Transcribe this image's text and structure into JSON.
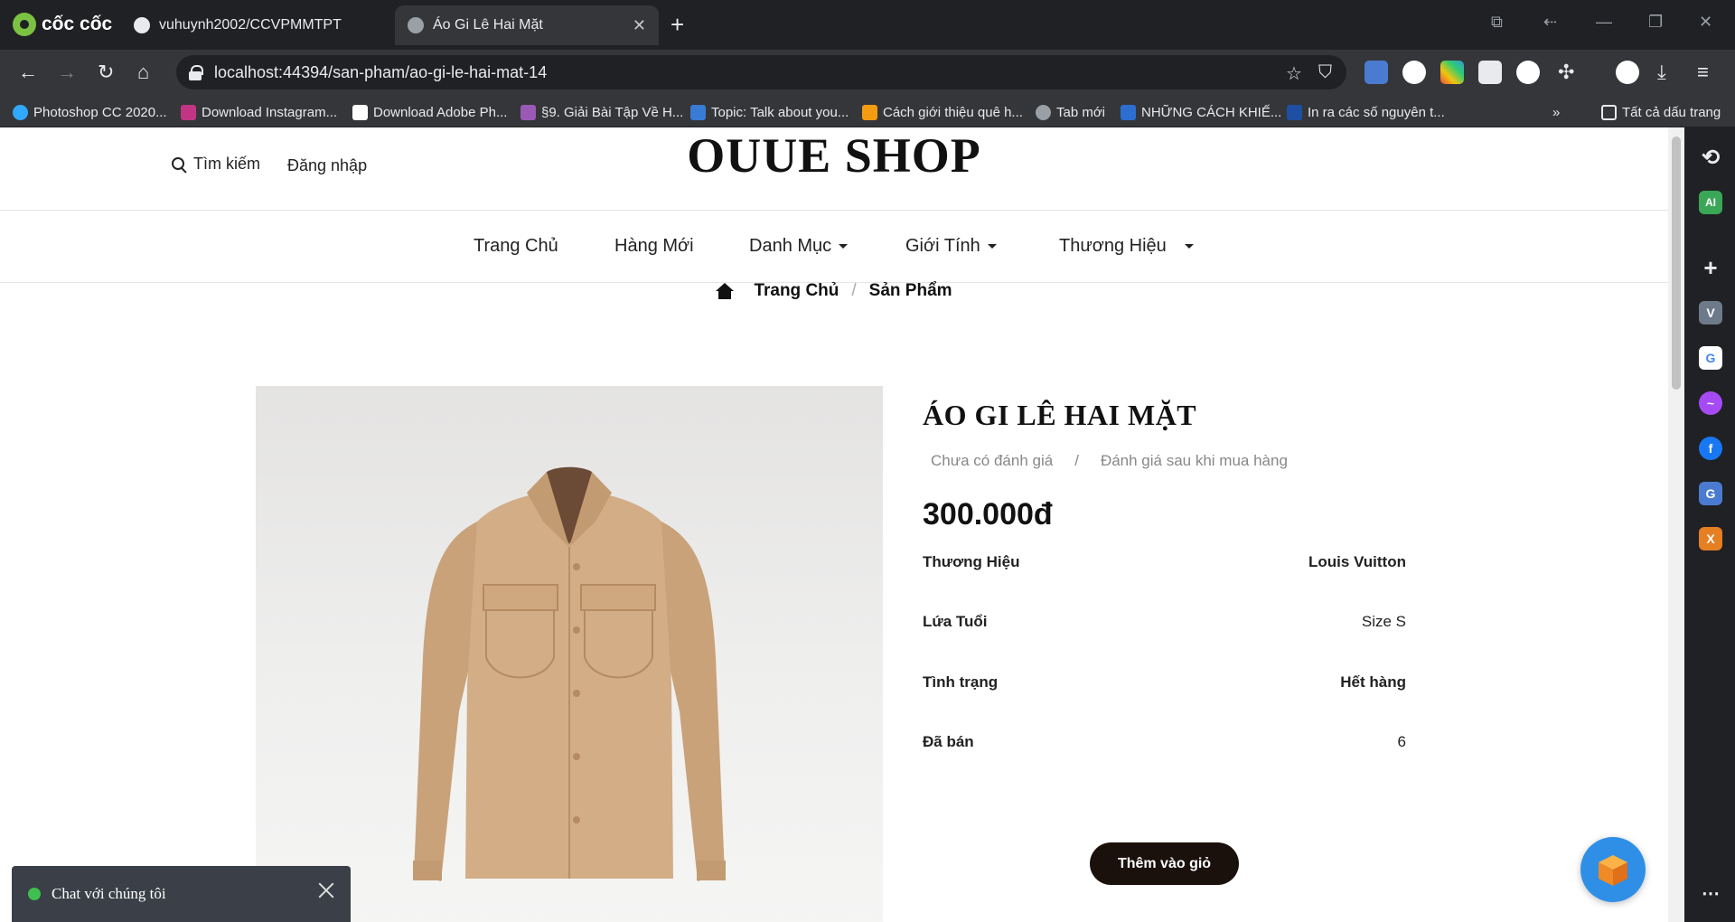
{
  "browser": {
    "brand": "cốc cốc",
    "tabs": [
      {
        "title": "vuhuynh2002/CCVPMMTPT",
        "active": false
      },
      {
        "title": "Áo Gi Lê Hai Mặt",
        "active": true
      }
    ],
    "url": "localhost:44394/san-pham/ao-gi-le-hai-mat-14",
    "bookmarks": [
      "Photoshop CC 2020...",
      "Download Instagram...",
      "Download Adobe Ph...",
      "§9. Giải Bài Tập Về H...",
      "Topic: Talk about you...",
      "Cách giới thiệu quê h...",
      "Tab mới",
      "NHỮNG CÁCH KHIẾ...",
      "In ra các số nguyên t..."
    ],
    "all_bookmarks": "Tất cả dấu trang"
  },
  "shop": {
    "name": "OUUE SHOP",
    "search_label": "Tìm kiếm",
    "login_label": "Đăng nhập",
    "nav": [
      "Trang Chủ",
      "Hàng Mới",
      "Danh Mục",
      "Giới Tính",
      "Thương Hiệu"
    ],
    "breadcrumb": {
      "home": "Trang Chủ",
      "current": "Sản Phẩm"
    }
  },
  "product": {
    "title": "ÁO GI LÊ HAI MẶT",
    "rating_text": "Chưa có đánh giá",
    "rating_sep": "/",
    "rating_note": "Đánh giá sau khi mua hàng",
    "price": "300.000đ",
    "specs": [
      {
        "label": "Thương Hiệu",
        "value": "Louis Vuitton"
      },
      {
        "label": "Lứa Tuổi",
        "value": "Size S"
      },
      {
        "label": "Tình trạng",
        "value": "Hết hàng"
      },
      {
        "label": "Đã bán",
        "value": "6"
      }
    ],
    "add_to_cart": "Thêm vào giỏ"
  },
  "chat": {
    "label": "Chat với chúng tôi",
    "status_color": "#3fbf4f"
  },
  "colors": {
    "cart_button": "#1a110c",
    "fab": "#2f8fe6",
    "chat_bg": "#3a3f48"
  }
}
